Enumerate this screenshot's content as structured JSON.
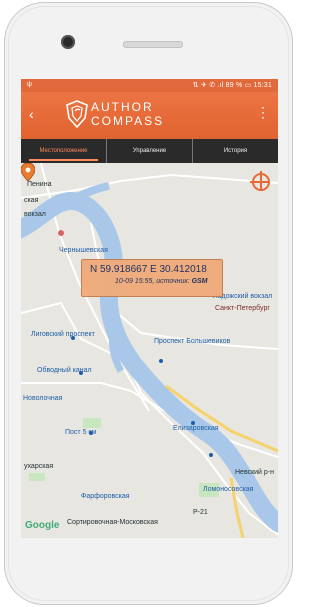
{
  "status": {
    "left_icon": "usb-icon",
    "right_text": "⇅ ✈ ✆ .ıl 89 %  ▭ 15:31"
  },
  "app": {
    "title_line1": "AUTHOR",
    "title_line2": "COMPASS",
    "back_icon": "back-arrow-icon",
    "menu_icon": "more-vertical-icon"
  },
  "tabs": [
    {
      "label": "Местоположение",
      "active": true
    },
    {
      "label": "Управление",
      "active": false
    },
    {
      "label": "История",
      "active": false
    }
  ],
  "popup": {
    "coordinates": "N 59.918667  E 30.412018",
    "info_prefix": "10-09 15:55, источник:",
    "source": "GSM"
  },
  "map_labels": [
    "Пенина",
    "ская",
    "вокзал",
    "Чернышевская",
    "Лиговский проспект",
    "Обводный канал",
    "Новолочная",
    "Пост 5 км",
    "ухарская",
    "Фарфоровская",
    "Сортировочная-Московская",
    "Проспект Большевиков",
    "Елизаровская",
    "Ломоносовская",
    "Невский р-н",
    "Ладожский вокзал",
    "Санкт-Петербург",
    "Р-21"
  ],
  "google_label": "Google",
  "colors": {
    "accent": "#e2693b",
    "tab_bg": "#2a2a2a",
    "water": "#a8c7e9",
    "road": "#f5d26b"
  }
}
